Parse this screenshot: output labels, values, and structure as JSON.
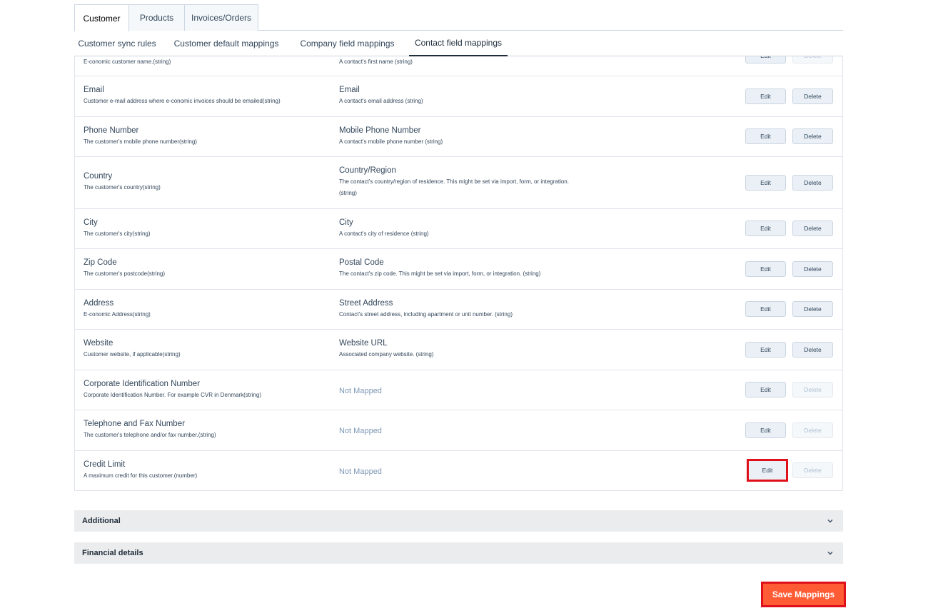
{
  "top_tabs": [
    "Customer",
    "Products",
    "Invoices/Orders"
  ],
  "sub_tabs": [
    "Customer sync rules",
    "Customer default mappings",
    "Company field mappings",
    "Contact field mappings"
  ],
  "partial_row": {
    "source_desc": "E-conomic customer name.(string)",
    "target_desc": "A contact's first name (string)"
  },
  "rows": [
    {
      "source": "Email",
      "source_desc": "Customer e-mail address where e-conomic invoices should be emailed(string)",
      "target": "Email",
      "target_desc": "A contact's email address (string)",
      "edit": "Edit",
      "delete": "Delete",
      "delete_enabled": true
    },
    {
      "source": "Phone Number",
      "source_desc": "The customer's mobile phone number(string)",
      "target": "Mobile Phone Number",
      "target_desc": "A contact's mobile phone number (string)",
      "edit": "Edit",
      "delete": "Delete",
      "delete_enabled": true
    },
    {
      "source": "Country",
      "source_desc": "The customer's country(string)",
      "target": "Country/Region",
      "target_desc": "The contact's country/region of residence. This might be set via import, form, or integration. (string)",
      "edit": "Edit",
      "delete": "Delete",
      "delete_enabled": true
    },
    {
      "source": "City",
      "source_desc": "The customer's city(string)",
      "target": "City",
      "target_desc": "A contact's city of residence (string)",
      "edit": "Edit",
      "delete": "Delete",
      "delete_enabled": true
    },
    {
      "source": "Zip Code",
      "source_desc": "The customer's postcode(string)",
      "target": "Postal Code",
      "target_desc": "The contact's zip code. This might be set via import, form, or integration. (string)",
      "edit": "Edit",
      "delete": "Delete",
      "delete_enabled": true
    },
    {
      "source": "Address",
      "source_desc": "E-conomic Address(string)",
      "target": "Street Address",
      "target_desc": "Contact's street address, including apartment or unit number. (string)",
      "edit": "Edit",
      "delete": "Delete",
      "delete_enabled": true
    },
    {
      "source": "Website",
      "source_desc": "Customer website, if applicable(string)",
      "target": "Website URL",
      "target_desc": "Associated company website. (string)",
      "edit": "Edit",
      "delete": "Delete",
      "delete_enabled": true
    },
    {
      "source": "Corporate Identification Number",
      "source_desc": "Corporate Identification Number. For example CVR in Denmark(string)",
      "target": "Not Mapped",
      "target_desc": "",
      "edit": "Edit",
      "delete": "Delete",
      "delete_enabled": false
    },
    {
      "source": "Telephone and Fax Number",
      "source_desc": "The customer's telephone and/or fax number.(string)",
      "target": "Not Mapped",
      "target_desc": "",
      "edit": "Edit",
      "delete": "Delete",
      "delete_enabled": false
    },
    {
      "source": "Credit Limit",
      "source_desc": "A maximum credit for this customer.(number)",
      "target": "Not Mapped",
      "target_desc": "",
      "edit": "Edit",
      "delete": "Delete",
      "delete_enabled": false
    }
  ],
  "sections": [
    "Additional",
    "Financial details"
  ],
  "save_label": "Save Mappings"
}
